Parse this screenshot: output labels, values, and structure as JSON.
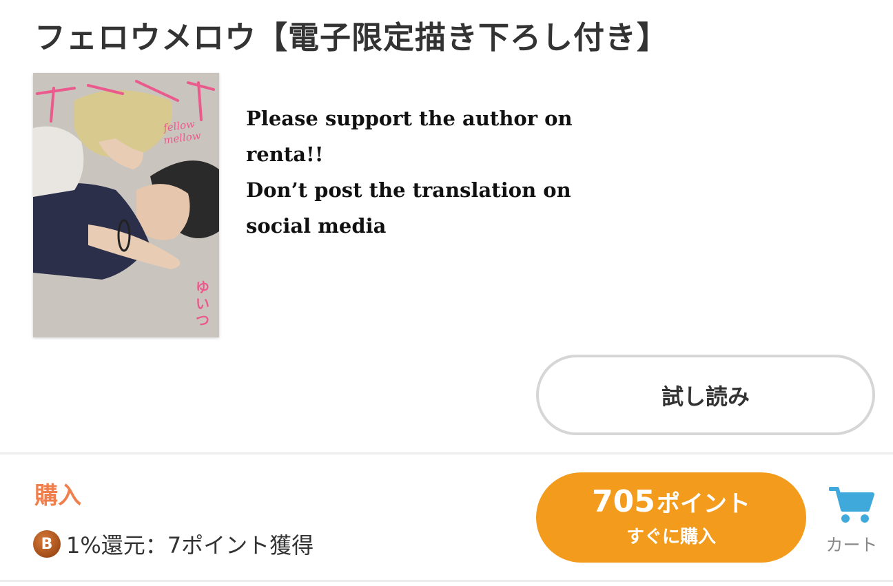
{
  "title": "フェロウメロウ【電子限定描き下ろし付き】",
  "cover": {
    "title_art": "フェロウメロウ",
    "subtitle_art": "fellow mellow",
    "author": "ゆいつ"
  },
  "notice_lines": [
    "Please support the author on",
    "renta!!",
    "Don’t post the translation on",
    "social media"
  ],
  "trial_button": {
    "label": "試し読み"
  },
  "purchase": {
    "label": "購入",
    "badge": "B",
    "points_text": "1%還元：7ポイント獲得",
    "buy_price": "705",
    "buy_unit": "ポイント",
    "buy_sub": "すぐに購入"
  },
  "cart": {
    "label": "カート",
    "icon": "cart-icon"
  },
  "colors": {
    "accent_orange": "#f29b1c",
    "purchase_label": "#ef7f4d",
    "cart_icon": "#3fa9dc"
  }
}
